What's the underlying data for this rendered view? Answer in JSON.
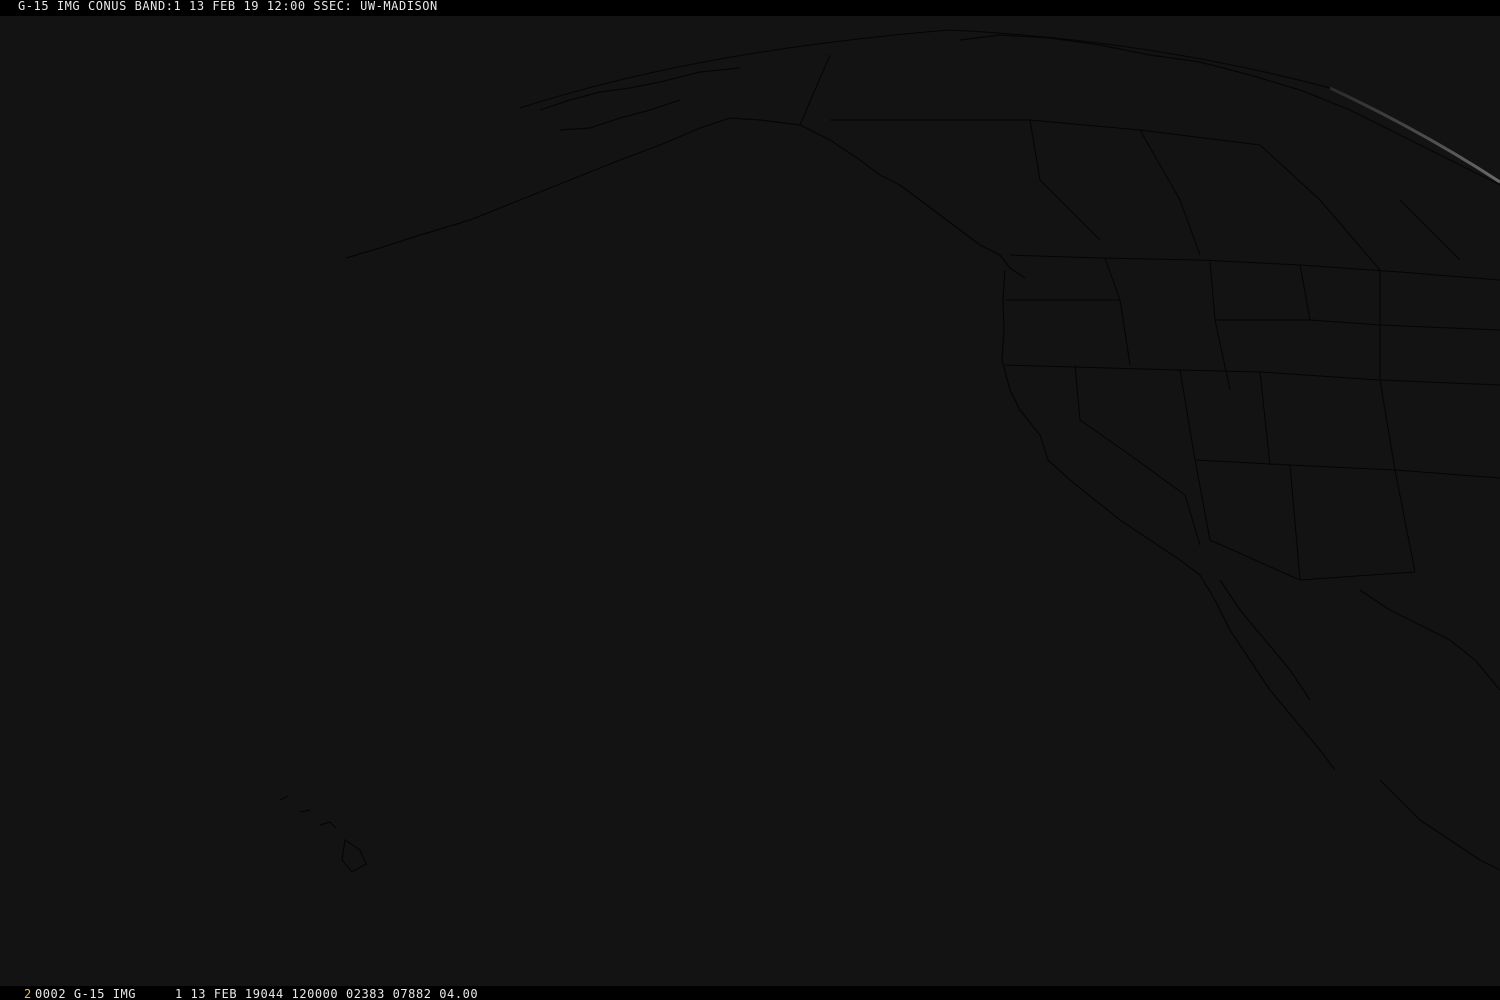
{
  "header": {
    "text": "G-15 IMG CONUS BAND:1 13 FEB 19 12:00 SSEC: UW-MADISON"
  },
  "footer": {
    "frame_number": "2",
    "text": "0002 G-15 IMG     1 13 FEB 19044 120000 02383 07882 04.00"
  },
  "colors": {
    "background": "#131313",
    "bar": "#000000",
    "text": "#e8e8e8",
    "frame_number": "#e5c034",
    "map_lines": "#050505",
    "earth_limb": "#5a5a5a"
  }
}
